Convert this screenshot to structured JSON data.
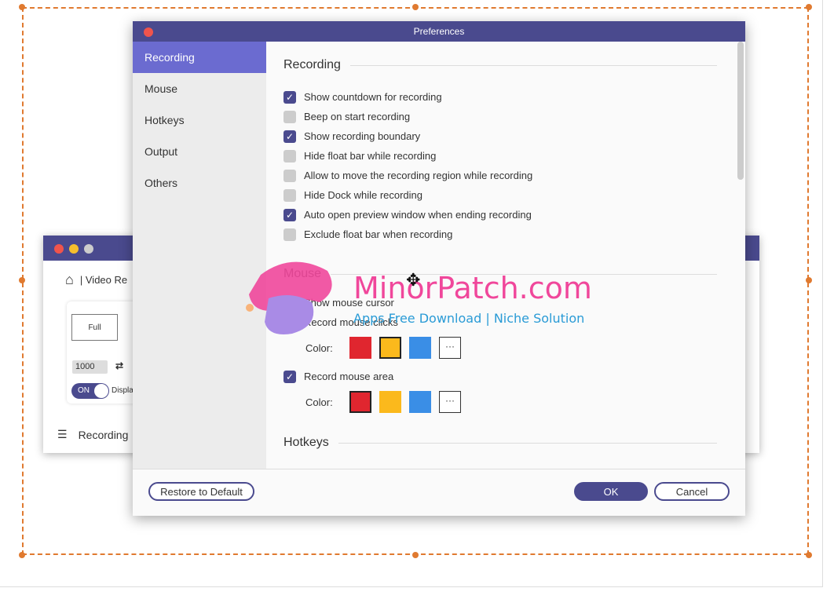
{
  "main_window": {
    "breadcrumb": "| Video Re",
    "full_label": "Full",
    "width_value": "1000",
    "toggle_label": "ON",
    "display_label": "Displa",
    "footer_label": "Recording"
  },
  "preferences": {
    "title": "Preferences",
    "sidebar": [
      {
        "label": "Recording"
      },
      {
        "label": "Mouse"
      },
      {
        "label": "Hotkeys"
      },
      {
        "label": "Output"
      },
      {
        "label": "Others"
      }
    ],
    "recording": {
      "heading": "Recording",
      "options": [
        {
          "label": "Show countdown for recording",
          "checked": true
        },
        {
          "label": "Beep on start recording",
          "checked": false
        },
        {
          "label": "Show recording boundary",
          "checked": true
        },
        {
          "label": "Hide float bar while recording",
          "checked": false
        },
        {
          "label": "Allow to move the recording region while recording",
          "checked": false
        },
        {
          "label": "Hide Dock while recording",
          "checked": false
        },
        {
          "label": "Auto open preview window when ending recording",
          "checked": true
        },
        {
          "label": "Exclude float bar when recording",
          "checked": false
        }
      ]
    },
    "mouse": {
      "heading": "Mouse",
      "show_cursor": "Show mouse cursor",
      "clicks": "Record mouse clicks",
      "area": "Record mouse area",
      "color_label": "Color:",
      "more": "···",
      "colors": [
        "#e0262f",
        "#fbb91c",
        "#3a8ee6"
      ]
    },
    "hotkeys": {
      "heading": "Hotkeys"
    },
    "restore": "Restore to Default",
    "ok": "OK",
    "cancel": "Cancel"
  },
  "watermark": {
    "title": "MinorPatch.com",
    "subtitle": "Apps Free Download | Niche Solution"
  }
}
